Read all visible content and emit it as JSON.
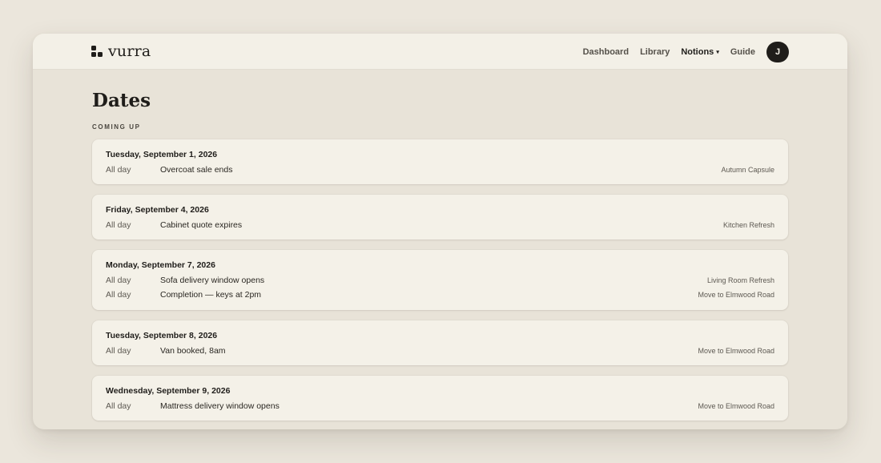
{
  "brand": {
    "name": "vurra"
  },
  "nav": {
    "items": [
      {
        "label": "Dashboard"
      },
      {
        "label": "Library"
      },
      {
        "label": "Notions",
        "dropdown": true
      },
      {
        "label": "Guide"
      }
    ],
    "caret_glyph": "▾",
    "avatar_initial": "J"
  },
  "page": {
    "title": "Dates",
    "section_label": "COMING UP"
  },
  "days": [
    {
      "date": "Tuesday, September 1, 2026",
      "events": [
        {
          "time": "All day",
          "title": "Overcoat sale ends",
          "project": "Autumn Capsule"
        }
      ]
    },
    {
      "date": "Friday, September 4, 2026",
      "events": [
        {
          "time": "All day",
          "title": "Cabinet quote expires",
          "project": "Kitchen Refresh"
        }
      ]
    },
    {
      "date": "Monday, September 7, 2026",
      "events": [
        {
          "time": "All day",
          "title": "Sofa delivery window opens",
          "project": "Living Room Refresh"
        },
        {
          "time": "All day",
          "title": "Completion — keys at 2pm",
          "project": "Move to Elmwood Road"
        }
      ]
    },
    {
      "date": "Tuesday, September 8, 2026",
      "events": [
        {
          "time": "All day",
          "title": "Van booked, 8am",
          "project": "Move to Elmwood Road"
        }
      ]
    },
    {
      "date": "Wednesday, September 9, 2026",
      "events": [
        {
          "time": "All day",
          "title": "Mattress delivery window opens",
          "project": "Move to Elmwood Road"
        }
      ]
    }
  ]
}
